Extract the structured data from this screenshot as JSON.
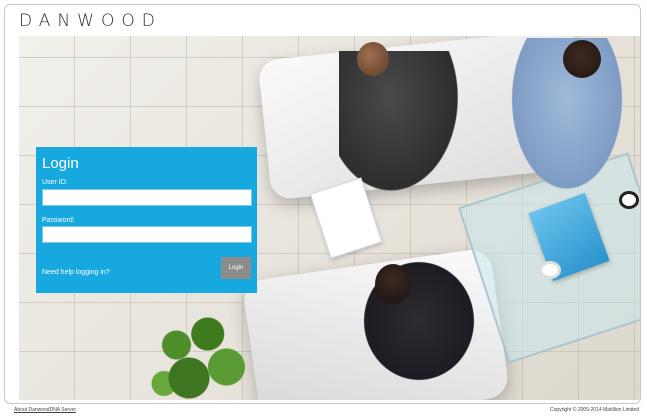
{
  "header": {
    "logo_text": "DANWOOD"
  },
  "hero": {
    "image_description_icon": "office-meeting-photo"
  },
  "login": {
    "title": "Login",
    "user_label": "User ID:",
    "user_value": "",
    "password_label": "Password:",
    "password_value": "",
    "help_link": "Need help logging in?",
    "button_label": "Login"
  },
  "footer": {
    "about_link": "About DanwoodDNA Server",
    "copyright": "Copyright © 2005-2014 Matillion Limited"
  },
  "colors": {
    "login_panel": "#17a8e0",
    "login_button": "#8c8c8c"
  }
}
